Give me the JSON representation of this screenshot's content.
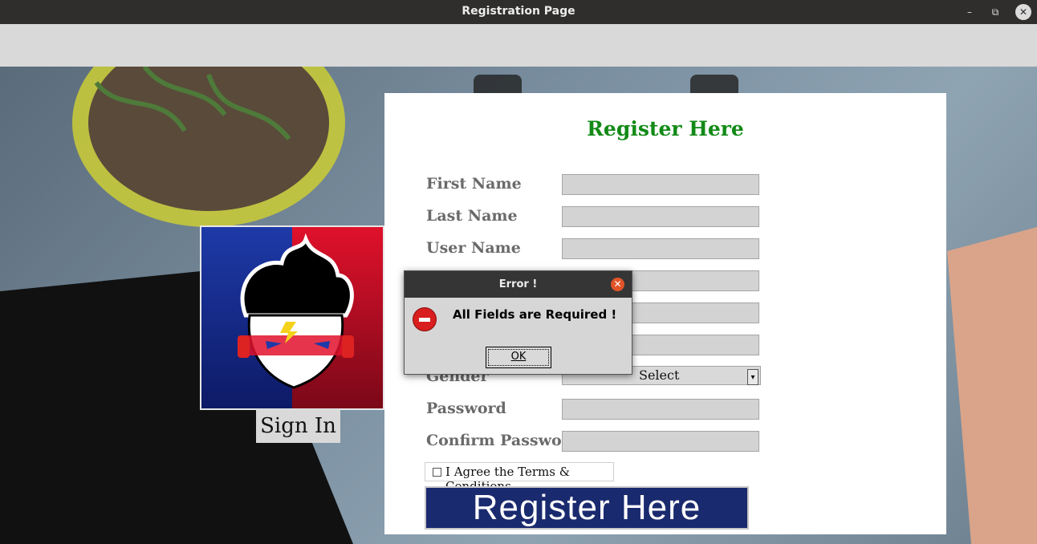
{
  "window": {
    "title": "Registration Page",
    "minimize_icon": "–",
    "maximize_icon": "⧉",
    "close_icon": "✕"
  },
  "signin": {
    "label": "Sign In"
  },
  "form": {
    "title": "Register Here",
    "fields": {
      "first_name": "First Name",
      "last_name": "Last Name",
      "user_name": "User Name",
      "gender": "Gender",
      "password": "Password",
      "confirm_password": "Confirm Password"
    },
    "gender_select": {
      "value": "Select"
    },
    "terms_label": "I Agree the Terms & Conditions",
    "register_button": "Register Here"
  },
  "dialog": {
    "title": "Error !",
    "message": "All Fields are Required !",
    "ok_label": "OK",
    "close_icon": "✕"
  },
  "colors": {
    "title_green": "#128a16",
    "button_blue": "#1a2a6e",
    "error_red": "#d81e1e"
  }
}
